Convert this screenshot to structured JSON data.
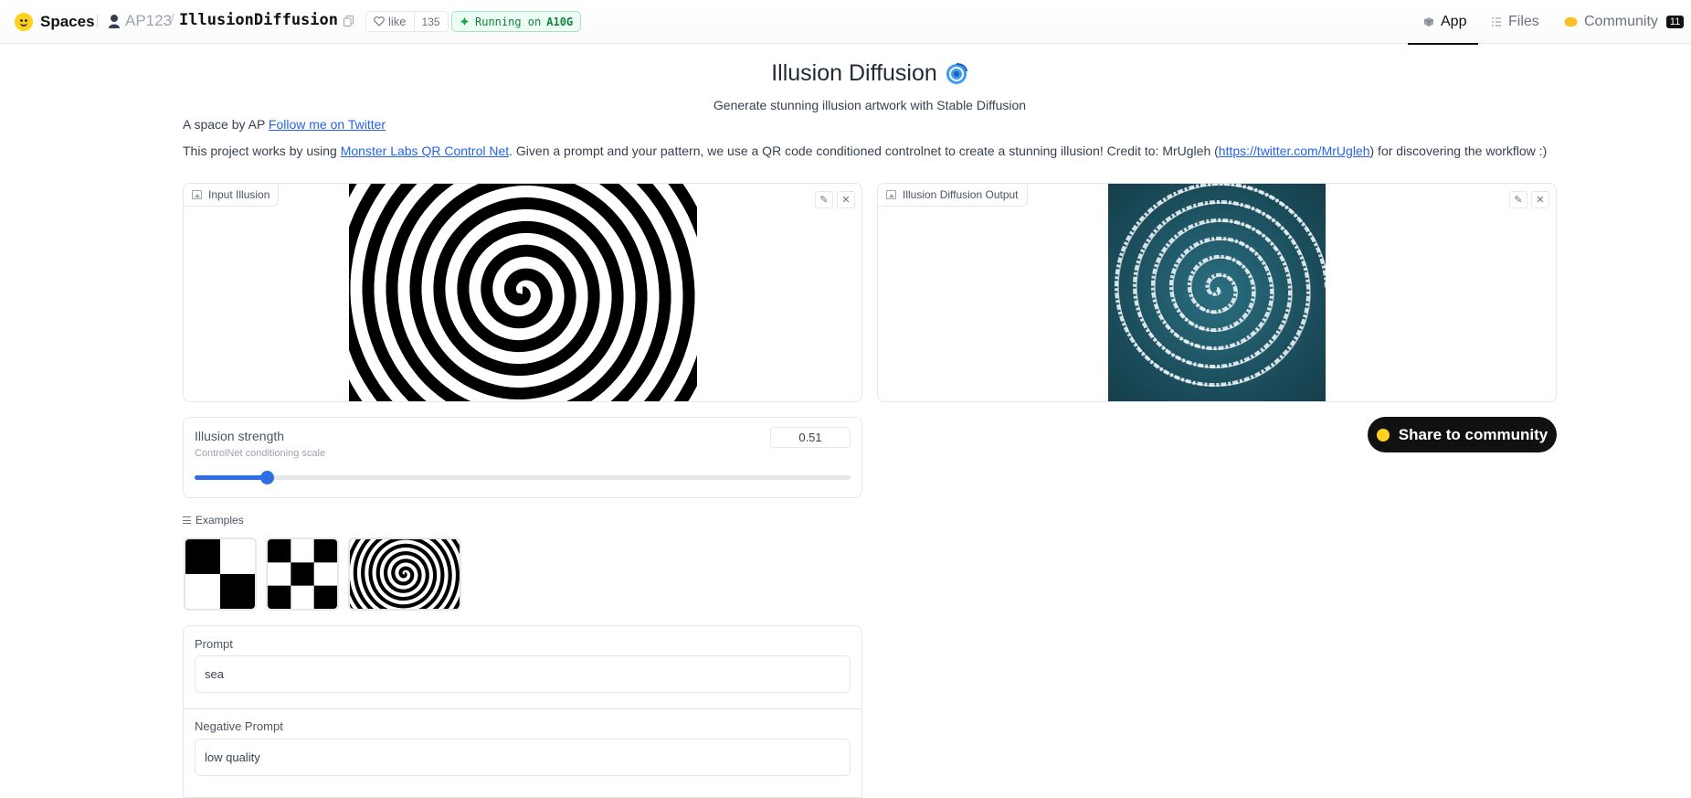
{
  "header": {
    "brand": "Spaces",
    "owner": "AP123",
    "slash": "/",
    "repo_name": "IllusionDiffusion",
    "like_label": "like",
    "like_count": "135",
    "status_prefix": "Running on",
    "status_hardware": "A10G",
    "tabs": [
      {
        "label": "App",
        "icon": "cube-icon",
        "active": true
      },
      {
        "label": "Files",
        "icon": "files-icon",
        "active": false
      },
      {
        "label": "Community",
        "icon": "community-icon",
        "active": false,
        "count": "11"
      }
    ]
  },
  "app": {
    "title": "Illusion Diffusion",
    "title_emoji": "🌀",
    "subtitle": "Generate stunning illusion artwork with Stable Diffusion",
    "byline_text": "A space by AP ",
    "byline_link": "Follow me on Twitter",
    "desc_before": "This project works by using ",
    "desc_link1": "Monster Labs QR Control Net",
    "desc_middle": ". Given a prompt and your pattern, we use a QR code conditioned controlnet to create a stunning illusion! Credit to: MrUgleh (",
    "desc_link2": "https://twitter.com/MrUgleh",
    "desc_after": ") for discovering the workflow :)"
  },
  "input_image": {
    "label": "Input Illusion"
  },
  "output_image": {
    "label": "Illusion Diffusion Output"
  },
  "strength": {
    "label": "Illusion strength",
    "info": "ControlNet conditioning scale",
    "value": "0.51",
    "slider_fraction": 0.11
  },
  "share_button": {
    "label": "Share to community"
  },
  "examples": {
    "label": "Examples",
    "items": [
      "checkerboard-2x2",
      "checkerboard-3x3",
      "spiral"
    ]
  },
  "prompt": {
    "label": "Prompt",
    "value": "sea"
  },
  "negative_prompt": {
    "label": "Negative Prompt",
    "value": "low quality"
  },
  "colors": {
    "accent": "#2f6fe6",
    "status_green": "#15803d",
    "brand_yellow": "#ffd21e"
  }
}
